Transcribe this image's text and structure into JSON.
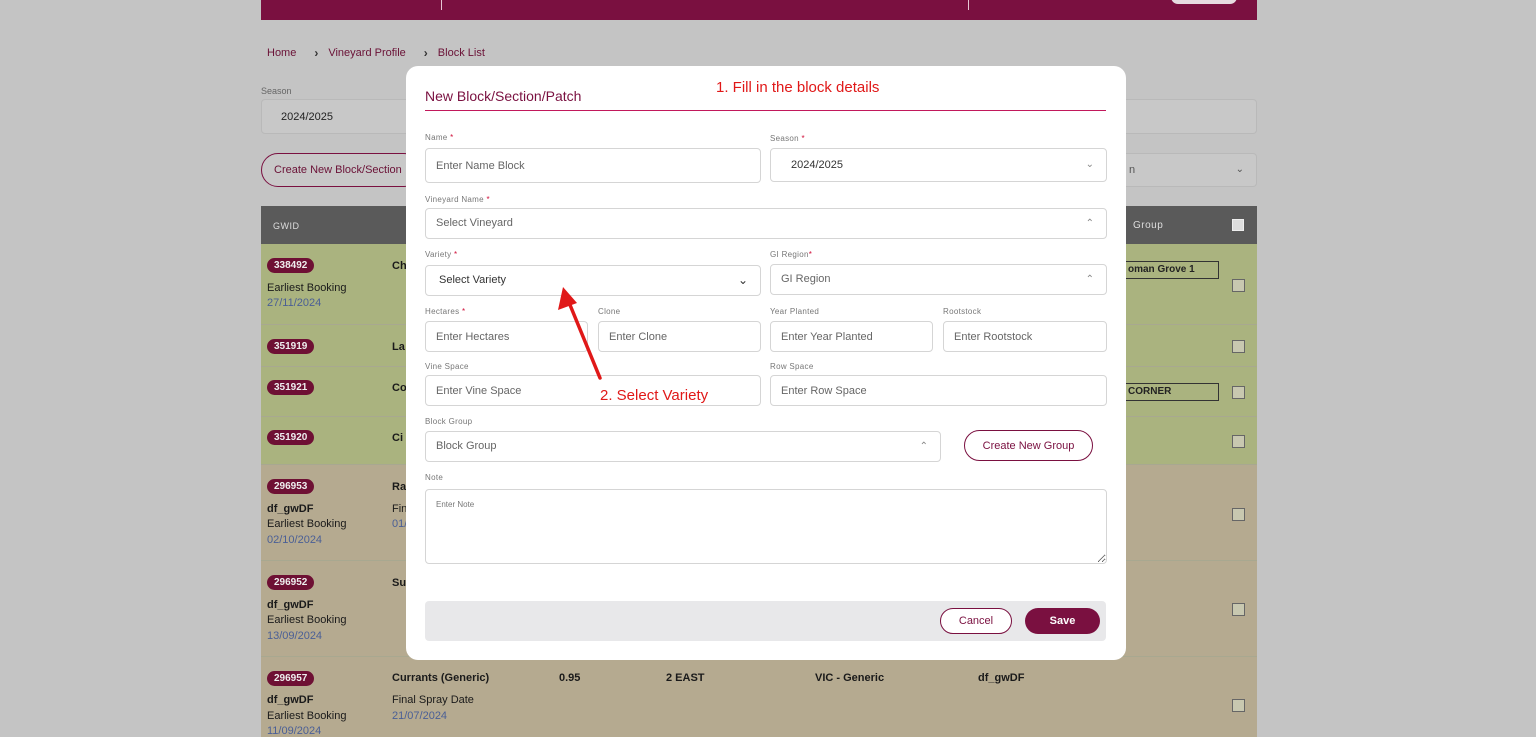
{
  "breadcrumb": {
    "home": "Home",
    "profile": "Vineyard Profile",
    "list": "Block List"
  },
  "page": {
    "season_label": "Season",
    "season_value": "2024/2025",
    "create_block_label": "Create New Block/Section",
    "filter_value": "n",
    "table_headers": {
      "gwid": "GWID",
      "group": "Group"
    }
  },
  "rows": [
    {
      "gwid": "338492",
      "col2": "Ch",
      "line2": "Earliest Booking",
      "line3": "27/11/2024",
      "tag": "oman Grove 1"
    },
    {
      "gwid": "351919",
      "col2": "La"
    },
    {
      "gwid": "351921",
      "col2": "Co",
      "tag": "CORNER"
    },
    {
      "gwid": "351920",
      "col2": "Ci"
    },
    {
      "gwid": "296953",
      "col2": "Ra",
      "col2b": "Fin",
      "col2c": "01/",
      "line1": "df_gwDF",
      "line2": "Earliest Booking",
      "line3": "02/10/2024"
    },
    {
      "gwid": "296952",
      "col2": "Su",
      "line1": "df_gwDF",
      "line2": "Earliest Booking",
      "line3": "13/09/2024"
    },
    {
      "gwid": "296957",
      "col2": "Currants (Generic)",
      "col2b": "Final Spray Date",
      "col2c": "21/07/2024",
      "hectares": "0.95",
      "block": "2 EAST",
      "region": "VIC - Generic",
      "owner": "df_gwDF",
      "line1": "df_gwDF",
      "line2": "Earliest Booking",
      "line3": "11/09/2024"
    }
  ],
  "modal": {
    "title": "New Block/Section/Patch",
    "annotation_1": "1. Fill in the block details",
    "annotation_2": "2. Select Variety",
    "name_label": "Name",
    "name_placeholder": "Enter Name Block",
    "season_label": "Season",
    "season_value": "2024/2025",
    "vineyard_label": "Vineyard Name",
    "vineyard_placeholder": "Select Vineyard",
    "variety_label": "Variety",
    "variety_placeholder": "Select Variety",
    "gi_label": "GI Region",
    "gi_placeholder": "GI Region",
    "hectares_label": "Hectares",
    "hectares_placeholder": "Enter Hectares",
    "clone_label": "Clone",
    "clone_placeholder": "Enter Clone",
    "year_label": "Year Planted",
    "year_placeholder": "Enter Year Planted",
    "rootstock_label": "Rootstock",
    "rootstock_placeholder": "Enter Rootstock",
    "vine_space_label": "Vine Space",
    "vine_space_placeholder": "Enter Vine Space",
    "row_space_label": "Row Space",
    "row_space_placeholder": "Enter Row Space",
    "block_group_label": "Block Group",
    "block_group_placeholder": "Block Group",
    "create_group_label": "Create New Group",
    "note_label": "Note",
    "note_placeholder": "Enter Note",
    "required_mark": "*",
    "cancel_label": "Cancel",
    "save_label": "Save"
  },
  "colors": {
    "brand": "#7a1040",
    "annotation": "#e01818"
  },
  "icons": {
    "chevron": "chevron-down-icon",
    "breadcrumb_sep": "chevron-right-icon"
  }
}
